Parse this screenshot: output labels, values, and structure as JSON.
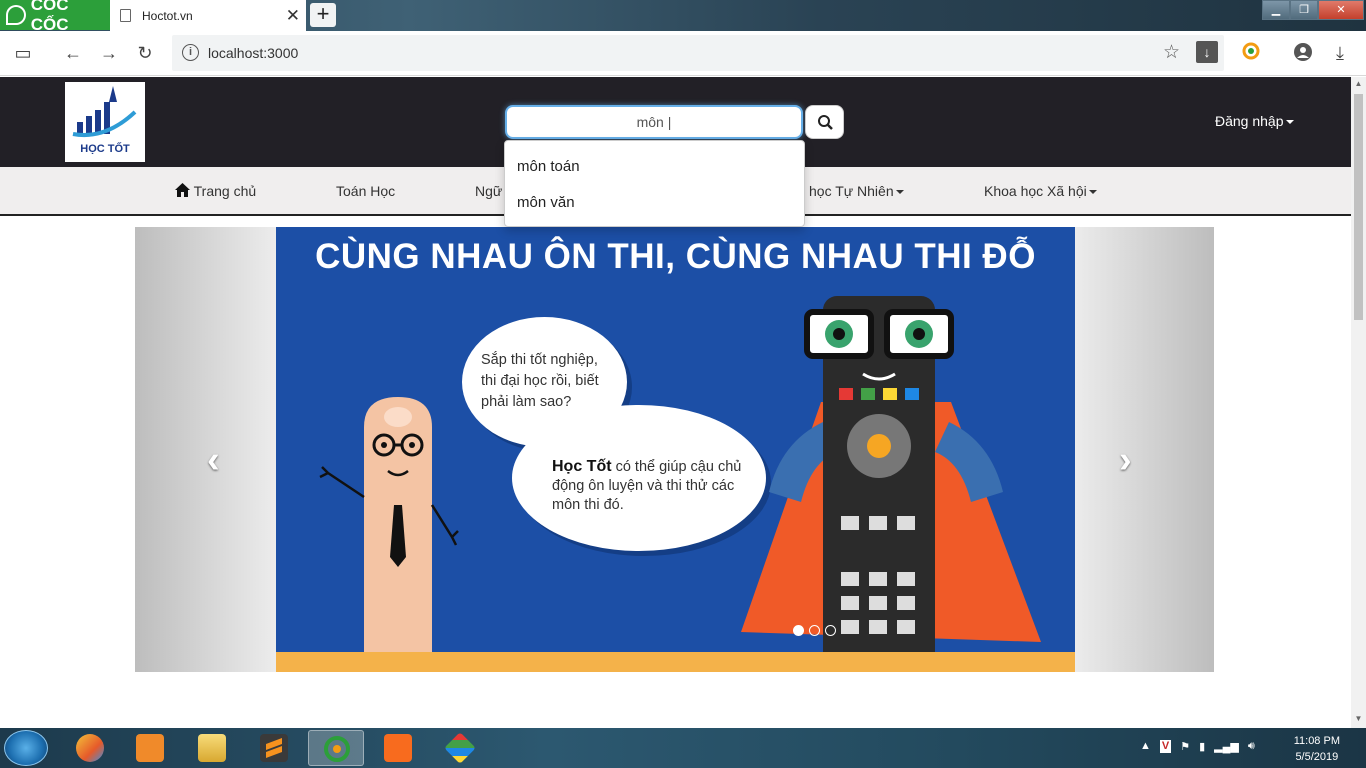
{
  "browser": {
    "brand": "CỐC CỐC",
    "tab_title": "Hoctot.vn",
    "tab_close": "✕",
    "new_tab": "+",
    "url": "localhost:3000"
  },
  "site": {
    "logo_text": "HỌC TỐT",
    "search_value": "môn |",
    "login_label": "Đăng nhập",
    "suggestions": [
      "môn toán",
      "môn văn"
    ],
    "nav": {
      "home": "Trang chủ",
      "math": "Toán Học",
      "literature": "Ngữ",
      "natural_sciences": "học Tự Nhiên",
      "social_sciences": "Khoa học Xã hội"
    }
  },
  "slide": {
    "headline": "CÙNG NHAU ÔN THI, CÙNG NHAU THI ĐỖ",
    "bubble1": "Sắp thi tốt nghiệp, thi đại học rồi, biết phải làm sao?",
    "bubble2_brand": "Học Tốt",
    "bubble2_text": "có thể giúp cậu chủ động ôn luyện và thi thử các môn thi đó.",
    "dots_count": 3,
    "active_dot": 1
  },
  "taskbar": {
    "time": "11:08 PM",
    "date": "5/5/2019"
  },
  "colors": {
    "header_bg": "#222026",
    "nav_bg": "#f0eeee",
    "slide_bg": "#1c4fa6",
    "cape": "#f05a28",
    "focus": "#66afe9"
  }
}
